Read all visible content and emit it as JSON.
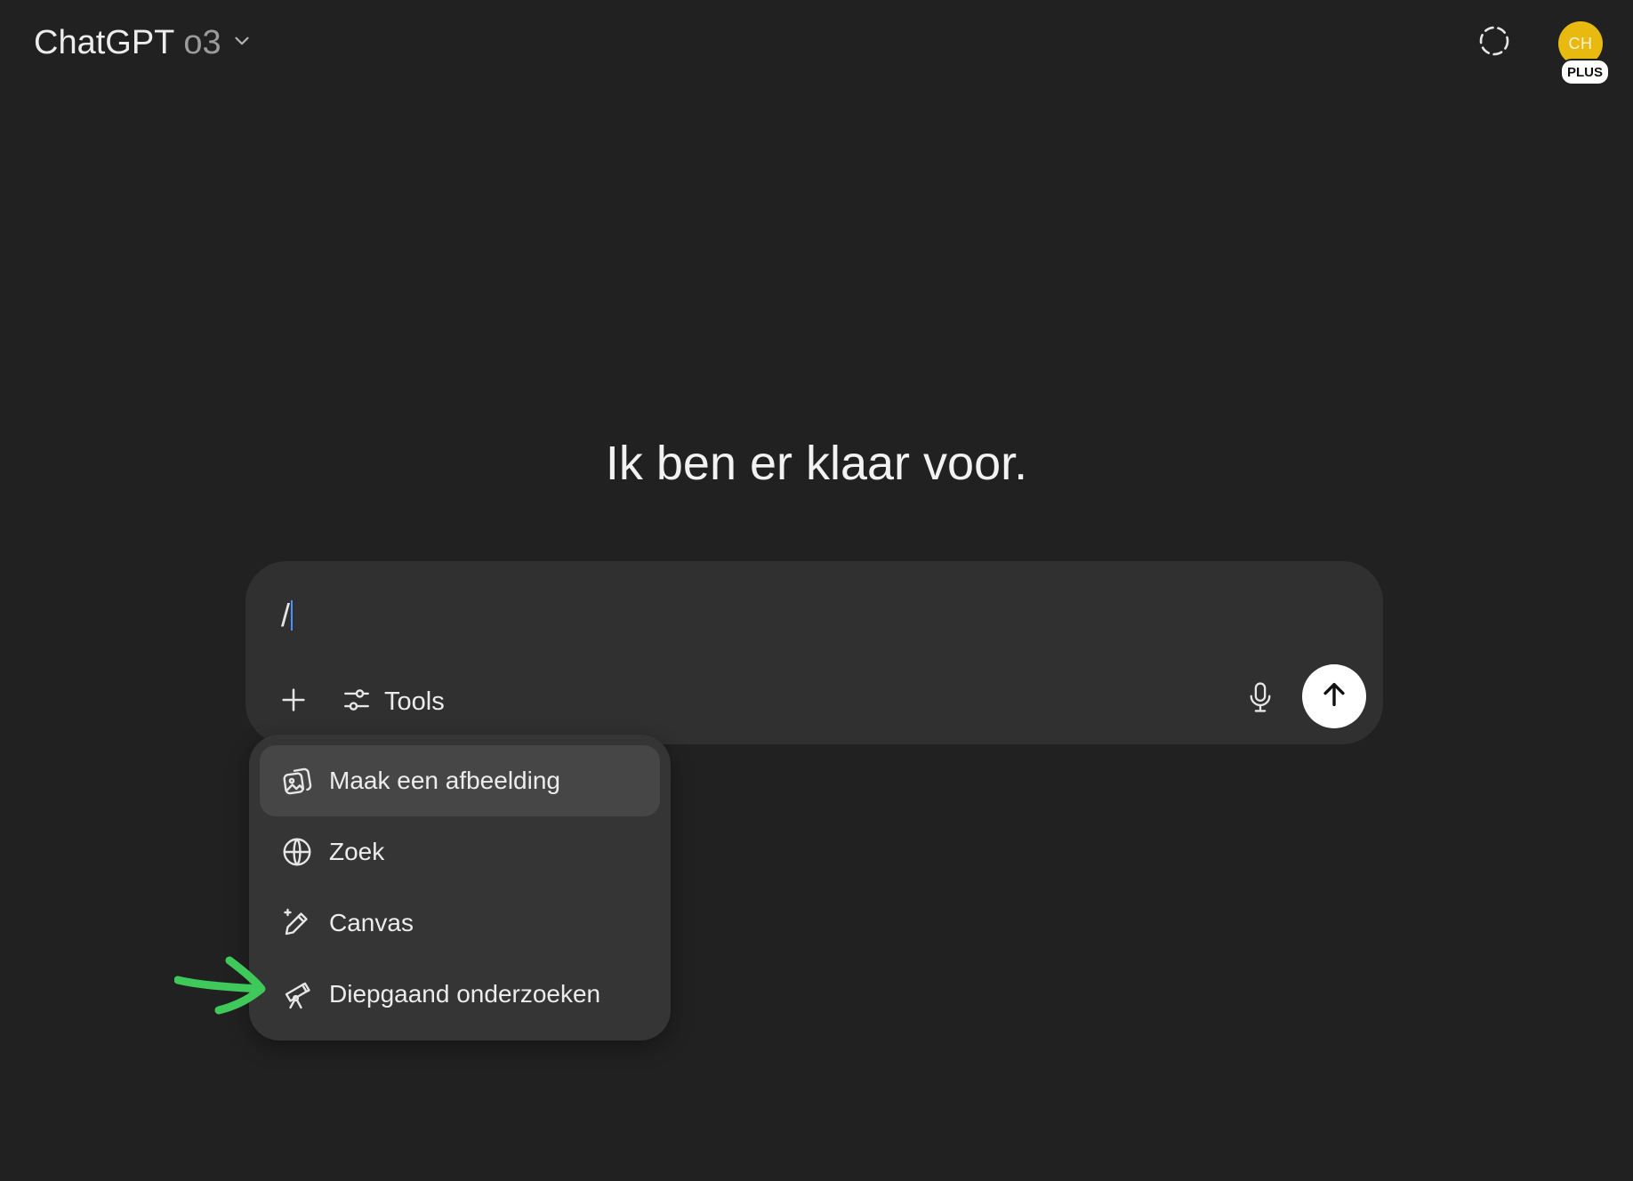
{
  "header": {
    "app_name": "ChatGPT",
    "model_version": "o3",
    "avatar_initials": "CH",
    "plan_badge": "PLUS"
  },
  "hero": {
    "greeting": "Ik ben er klaar voor."
  },
  "composer": {
    "input_value": "/",
    "tools_label": "Tools"
  },
  "slash_menu": {
    "items": [
      {
        "label": "Maak een afbeelding",
        "icon": "image-icon",
        "highlighted": true
      },
      {
        "label": "Zoek",
        "icon": "globe-icon",
        "highlighted": false
      },
      {
        "label": "Canvas",
        "icon": "pencil-sparkle-icon",
        "highlighted": false
      },
      {
        "label": "Diepgaand onderzoeken",
        "icon": "telescope-icon",
        "highlighted": false
      }
    ]
  },
  "colors": {
    "background": "#212121",
    "composer": "#303030",
    "menu": "#353535",
    "menu_highlight": "#464646",
    "avatar": "#e8b90f",
    "annotation_arrow": "#3ec95a"
  }
}
